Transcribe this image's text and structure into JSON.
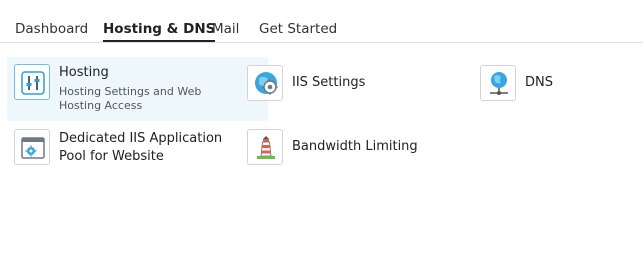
{
  "tabs": [
    {
      "label": "Dashboard",
      "active": false
    },
    {
      "label": "Hosting & DNS",
      "active": true
    },
    {
      "label": "Mail",
      "active": false
    },
    {
      "label": "Get Started",
      "active": false
    }
  ],
  "items": {
    "hosting": {
      "title": "Hosting",
      "description": "Hosting Settings and Web Hosting Access",
      "icon": "sliders-icon"
    },
    "iis": {
      "title": "IIS Settings",
      "icon": "gear-globe-icon"
    },
    "dns": {
      "title": "DNS",
      "icon": "globe-network-icon"
    },
    "pool": {
      "title": "Dedicated IIS Application Pool for Website",
      "icon": "app-window-gear-icon"
    },
    "bandwidth": {
      "title": "Bandwidth Limiting",
      "icon": "lighthouse-icon"
    }
  },
  "colors": {
    "accent": "#2a9fd8",
    "selected_bg": "#eef7fc"
  }
}
